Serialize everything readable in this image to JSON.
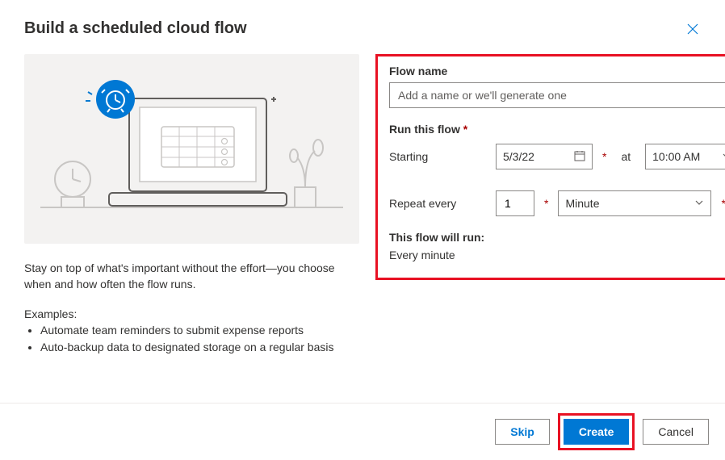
{
  "dialog": {
    "title": "Build a scheduled cloud flow",
    "description": "Stay on top of what's important without the effort—you choose when and how often the flow runs.",
    "examples_label": "Examples:",
    "examples": [
      "Automate team reminders to submit expense reports",
      "Auto-backup data to designated storage on a regular basis"
    ]
  },
  "form": {
    "flow_name_label": "Flow name",
    "flow_name_placeholder": "Add a name or we'll generate one",
    "flow_name_value": "",
    "run_label": "Run this flow",
    "starting_label": "Starting",
    "starting_date": "5/3/22",
    "at_label": "at",
    "starting_time": "10:00 AM",
    "repeat_label": "Repeat every",
    "repeat_value": "1",
    "repeat_unit": "Minute",
    "summary_label": "This flow will run:",
    "summary_text": "Every minute"
  },
  "footer": {
    "skip": "Skip",
    "create": "Create",
    "cancel": "Cancel"
  }
}
